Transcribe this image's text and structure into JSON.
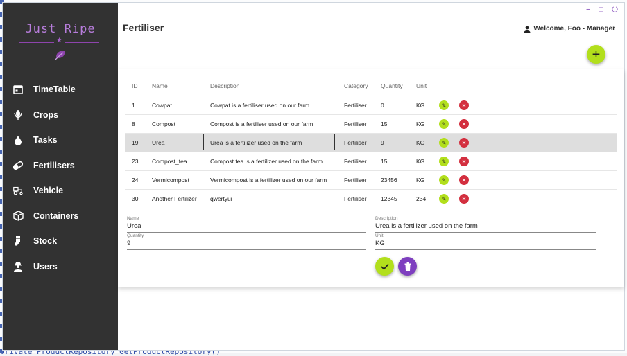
{
  "app": {
    "logo_text": "Just Ripe",
    "page_title": "Fertiliser",
    "welcome": "Welcome, Foo - Manager",
    "colors": {
      "accent_green": "#b2df1c",
      "accent_purple": "#7e3fbf",
      "sidebar_bg": "#323232",
      "delete_red": "#d32f3f"
    }
  },
  "window_controls": {
    "minimize": "−",
    "maximize": "□",
    "power": "⏻"
  },
  "sidebar": {
    "items": [
      {
        "label": "TimeTable",
        "icon": "calendar-icon"
      },
      {
        "label": "Crops",
        "icon": "crop-icon"
      },
      {
        "label": "Tasks",
        "icon": "drop-icon"
      },
      {
        "label": "Fertilisers",
        "icon": "capsule-icon"
      },
      {
        "label": "Vehicle",
        "icon": "tractor-icon"
      },
      {
        "label": "Containers",
        "icon": "box-icon"
      },
      {
        "label": "Stock",
        "icon": "sock-icon"
      },
      {
        "label": "Users",
        "icon": "user-worker-icon"
      }
    ]
  },
  "fab": {
    "add_label": "+"
  },
  "table": {
    "headers": [
      "ID",
      "Name",
      "Description",
      "Category",
      "Quantity",
      "Unit"
    ],
    "rows": [
      [
        "1",
        "Cowpat",
        "Cowpat is a fertiliser used on our farm",
        "Fertiliser",
        "0",
        "KG"
      ],
      [
        "8",
        "Compost",
        "Compost is a fertiliser used on our farm",
        "Fertiliser",
        "15",
        "KG"
      ],
      [
        "19",
        "Urea",
        "Urea is a fertilizer used on the farm",
        "Fertiliser",
        "9",
        "KG"
      ],
      [
        "23",
        "Compost_tea",
        "Compost tea is a fertilizer used on the farm",
        "Fertiliser",
        "15",
        "KG"
      ],
      [
        "24",
        "Vermicompost",
        "Vermicompost is a fertilizer used on our farm",
        "Fertiliser",
        "23456",
        "KG"
      ],
      [
        "30",
        "Another Fertilizer",
        "qwertyui",
        "Fertiliser",
        "12345",
        "234"
      ]
    ],
    "selected_row": 2
  },
  "form": {
    "name_label": "Name",
    "name_value": "Urea",
    "description_label": "Description",
    "description_value": "Urea is a fertilizer used on the farm",
    "quantity_label": "Quantity",
    "quantity_value": "9",
    "unit_label": "Unit",
    "unit_value": "KG"
  },
  "background": {
    "code_line": "private ProductRepository GetProductRepository()"
  }
}
